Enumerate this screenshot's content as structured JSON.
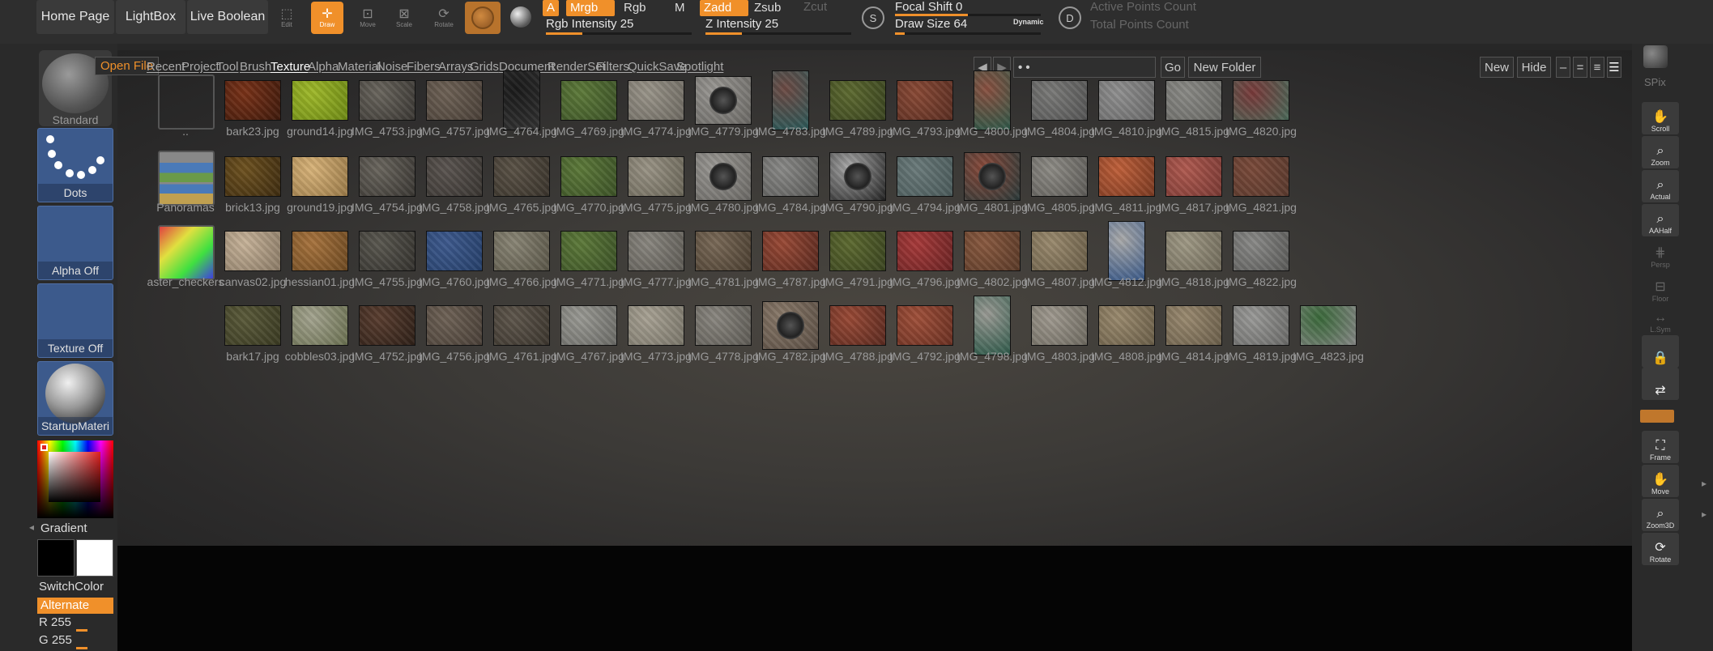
{
  "topbar": {
    "home_page": "Home Page",
    "lightbox": "LightBox",
    "live_boolean": "Live Boolean",
    "tools": {
      "edit": "Edit",
      "draw": "Draw",
      "move": "Move",
      "scale": "Scale",
      "rotate": "Rotate"
    },
    "a": "A",
    "mrgb": "Mrgb",
    "rgb": "Rgb",
    "m": "M",
    "rgb_intensity": {
      "label": "Rgb Intensity 25",
      "value": 25,
      "max": 100
    },
    "zadd": "Zadd",
    "zsub": "Zsub",
    "zcut": "Zcut",
    "z_intensity": {
      "label": "Z Intensity 25",
      "value": 25,
      "max": 100
    },
    "s_icon": "S",
    "focal_shift": {
      "label": "Focal Shift 0",
      "value": 0,
      "min": -100,
      "max": 100
    },
    "draw_size": {
      "label": "Draw Size 64",
      "value": 64,
      "max": 1000
    },
    "dynamic": "Dynamic",
    "d_icon": "D",
    "active_points": "Active Points Count",
    "total_points": "Total Points Count"
  },
  "leftshelf": {
    "brush": "Standard",
    "stroke": "Dots",
    "alpha": "Alpha Off",
    "texture": "Texture Off",
    "material": "StartupMateri",
    "gradient": "Gradient",
    "switchcolor": "SwitchColor",
    "alternate": "Alternate",
    "r": "R 255",
    "g": "G 255",
    "colors": {
      "main": "#000000",
      "secondary": "#ffffff"
    }
  },
  "lightbox": {
    "tabs": [
      "Open File",
      "Recent",
      "Project",
      "Tool",
      "Brush",
      "Texture",
      "Alpha",
      "Material",
      "Noise",
      "Fibers",
      "Arrays",
      "Grids",
      "Document",
      "RenderSet",
      "Filters",
      "QuickSave",
      "Spotlight"
    ],
    "path_value": "• •",
    "go": "Go",
    "new_folder": "New Folder",
    "new": "New",
    "hide": "Hide",
    "columns": [
      [
        "..",
        "Panoramas",
        "aster_checkers",
        ""
      ],
      [
        "bark23.jpg",
        "brick13.jpg",
        "canvas02.jpg",
        "bark17.jpg"
      ],
      [
        "ground14.jpg",
        "ground19.jpg",
        "hessian01.jpg",
        "cobbles03.jpg"
      ],
      [
        "IMG_4753.jpg",
        "IMG_4754.jpg",
        "IMG_4755.jpg",
        "IMG_4752.jpg"
      ],
      [
        "IMG_4757.jpg",
        "IMG_4758.jpg",
        "IMG_4760.jpg",
        "IMG_4756.jpg"
      ],
      [
        "IMG_4764.jpg",
        "IMG_4765.jpg",
        "IMG_4766.jpg",
        "IMG_4761.jpg"
      ],
      [
        "IMG_4769.jpg",
        "IMG_4770.jpg",
        "IMG_4771.jpg",
        "IMG_4767.jpg"
      ],
      [
        "IMG_4774.jpg",
        "IMG_4775.jpg",
        "IMG_4777.jpg",
        "IMG_4773.jpg"
      ],
      [
        "IMG_4779.jpg",
        "IMG_4780.jpg",
        "IMG_4781.jpg",
        "IMG_4778.jpg"
      ],
      [
        "IMG_4783.jpg",
        "IMG_4784.jpg",
        "IMG_4787.jpg",
        "IMG_4782.jpg"
      ],
      [
        "IMG_4789.jpg",
        "IMG_4790.jpg",
        "IMG_4791.jpg",
        "IMG_4788.jpg"
      ],
      [
        "IMG_4793.jpg",
        "IMG_4794.jpg",
        "IMG_4796.jpg",
        "IMG_4792.jpg"
      ],
      [
        "IMG_4800.jpg",
        "IMG_4801.jpg",
        "IMG_4802.jpg",
        "IMG_4798.jpg"
      ],
      [
        "IMG_4804.jpg",
        "IMG_4805.jpg",
        "IMG_4807.jpg",
        "IMG_4803.jpg"
      ],
      [
        "IMG_4810.jpg",
        "IMG_4811.jpg",
        "IMG_4812.jpg",
        "IMG_4808.jpg"
      ],
      [
        "IMG_4815.jpg",
        "IMG_4817.jpg",
        "IMG_4818.jpg",
        "IMG_4814.jpg"
      ],
      [
        "IMG_4820.jpg",
        "IMG_4821.jpg",
        "IMG_4822.jpg",
        "IMG_4819.jpg"
      ],
      [
        "",
        "",
        "",
        "IMG_4823.jpg"
      ]
    ]
  },
  "rightshelf": {
    "spix": "SPix",
    "buttons": [
      "Scroll",
      "Zoom",
      "Actual",
      "AAHalf",
      "Persp",
      "Floor",
      "L.Sym",
      "",
      "",
      "Frame",
      "Move",
      "Zoom3D",
      "Rotate"
    ]
  }
}
